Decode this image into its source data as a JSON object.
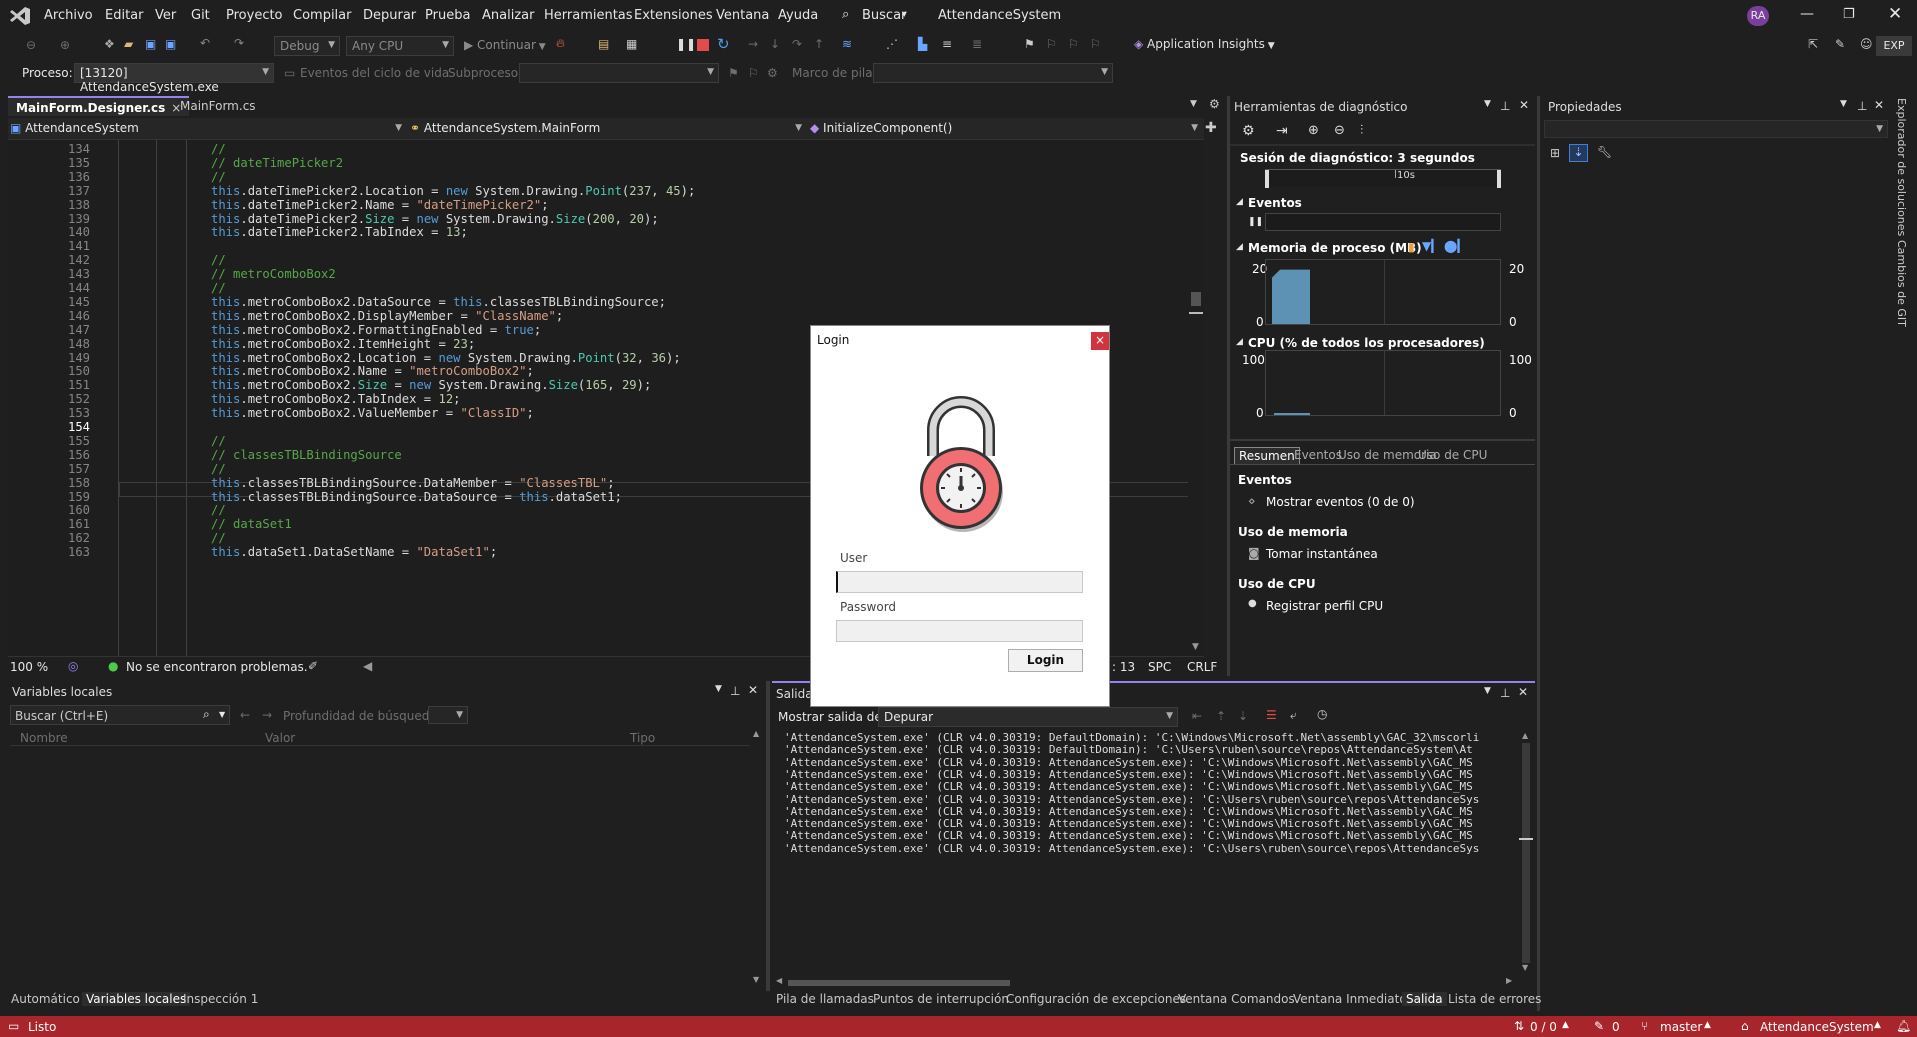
{
  "menu": [
    "Archivo",
    "Editar",
    "Ver",
    "Git",
    "Proyecto",
    "Compilar",
    "Depurar",
    "Prueba",
    "Analizar",
    "Herramientas",
    "Extensiones",
    "Ventana",
    "Ayuda"
  ],
  "search_label": "Buscar",
  "solution_title": "AttendanceSystem",
  "user_initials": "RA",
  "exp_label": "EXP",
  "toolbar": {
    "config": "Debug",
    "platform": "Any CPU",
    "continue_label": "Continuar",
    "app_insights": "Application Insights"
  },
  "toolbar2": {
    "process_label": "Proceso:",
    "process_value": "[13120] AttendanceSystem.exe",
    "lifecycle_label": "Eventos del ciclo de vida",
    "subprocess_label": "Subproceso:",
    "stackframe_label": "Marco de pila:"
  },
  "tabs": [
    "MainForm.Designer.cs",
    "MainForm.cs"
  ],
  "navbar": {
    "project": "AttendanceSystem",
    "class": "AttendanceSystem.MainForm",
    "method": "InitializeComponent()"
  },
  "code_lines": [
    {
      "n": "134",
      "t": "//"
    },
    {
      "n": "135",
      "t": "// dateTimePicker2"
    },
    {
      "n": "136",
      "t": "//"
    },
    {
      "n": "137",
      "t": "this.dateTimePicker2.Location = new System.Drawing.Point(237, 45);"
    },
    {
      "n": "138",
      "t": "this.dateTimePicker2.Name = \"dateTimePicker2\";"
    },
    {
      "n": "139",
      "t": "this.dateTimePicker2.Size = new System.Drawing.Size(200, 20);"
    },
    {
      "n": "140",
      "t": "this.dateTimePicker2.TabIndex = 13;"
    },
    {
      "n": "141",
      "t": ""
    },
    {
      "n": "142",
      "t": "//"
    },
    {
      "n": "143",
      "t": "// metroComboBox2"
    },
    {
      "n": "144",
      "t": "//"
    },
    {
      "n": "145",
      "t": "this.metroComboBox2.DataSource = this.classesTBLBindingSource;"
    },
    {
      "n": "146",
      "t": "this.metroComboBox2.DisplayMember = \"ClassName\";"
    },
    {
      "n": "147",
      "t": "this.metroComboBox2.FormattingEnabled = true;"
    },
    {
      "n": "148",
      "t": "this.metroComboBox2.ItemHeight = 23;"
    },
    {
      "n": "149",
      "t": "this.metroComboBox2.Location = new System.Drawing.Point(32, 36);"
    },
    {
      "n": "150",
      "t": "this.metroComboBox2.Name = \"metroComboBox2\";"
    },
    {
      "n": "151",
      "t": "this.metroComboBox2.Size = new System.Drawing.Size(165, 29);"
    },
    {
      "n": "152",
      "t": "this.metroComboBox2.TabIndex = 12;"
    },
    {
      "n": "153",
      "t": "this.metroComboBox2.ValueMember = \"ClassID\";"
    },
    {
      "n": "154",
      "t": ""
    },
    {
      "n": "155",
      "t": "//"
    },
    {
      "n": "156",
      "t": "// classesTBLBindingSource"
    },
    {
      "n": "157",
      "t": "//"
    },
    {
      "n": "158",
      "t": "this.classesTBLBindingSource.DataMember = \"ClassesTBL\";"
    },
    {
      "n": "159",
      "t": "this.classesTBLBindingSource.DataSource = this.dataSet1;"
    },
    {
      "n": "160",
      "t": "//"
    },
    {
      "n": "161",
      "t": "// dataSet1"
    },
    {
      "n": "162",
      "t": "//"
    },
    {
      "n": "163",
      "t": "this.dataSet1.DataSetName = \"DataSet1\";"
    }
  ],
  "editor_status": {
    "zoom": "100 %",
    "problems": "No se encontraron problemas.",
    "col": ": 13",
    "spc": "SPC",
    "crlf": "CRLF"
  },
  "diag": {
    "title": "Herramientas de diagnóstico",
    "session": "Sesión de diagnóstico: 3 segundos",
    "timeline_tick": "10s",
    "events": "Eventos",
    "memory_title": "Memoria de proceso (MB)",
    "mem_max": "20",
    "mem_min": "0",
    "cpu_title": "CPU (% de todos los procesadores)",
    "cpu_max": "100",
    "cpu_min": "0",
    "tabs": [
      "Resumen",
      "Eventos",
      "Uso de memoria",
      "Uso de CPU"
    ],
    "sec_events": "Eventos",
    "show_events": "Mostrar eventos (0 de 0)",
    "sec_memory": "Uso de memoria",
    "snapshot": "Tomar instantánea",
    "sec_cpu": "Uso de CPU",
    "cpu_profile": "Registrar perfil CPU",
    "memory_fill": 0.85
  },
  "properties": {
    "title": "Propiedades"
  },
  "side_tabs": [
    "Explorador de soluciones",
    "Cambios de GIT"
  ],
  "locals": {
    "title": "Variables locales",
    "search_placeholder": "Buscar (Ctrl+E)",
    "depth_label": "Profundidad de búsqueda:",
    "col_name": "Nombre",
    "col_value": "Valor",
    "col_type": "Tipo"
  },
  "output": {
    "title": "Salida",
    "show_from": "Mostrar salida de:",
    "source": "Depurar",
    "lines": [
      "'AttendanceSystem.exe' (CLR v4.0.30319: DefaultDomain): 'C:\\Windows\\Microsoft.Net\\assembly\\GAC_32\\mscorli",
      "'AttendanceSystem.exe' (CLR v4.0.30319: DefaultDomain): 'C:\\Users\\ruben\\source\\repos\\AttendanceSystem\\At",
      "'AttendanceSystem.exe' (CLR v4.0.30319: AttendanceSystem.exe): 'C:\\Windows\\Microsoft.Net\\assembly\\GAC_MS",
      "'AttendanceSystem.exe' (CLR v4.0.30319: AttendanceSystem.exe): 'C:\\Windows\\Microsoft.Net\\assembly\\GAC_MS",
      "'AttendanceSystem.exe' (CLR v4.0.30319: AttendanceSystem.exe): 'C:\\Windows\\Microsoft.Net\\assembly\\GAC_MS",
      "'AttendanceSystem.exe' (CLR v4.0.30319: AttendanceSystem.exe): 'C:\\Users\\ruben\\source\\repos\\AttendanceSys",
      "'AttendanceSystem.exe' (CLR v4.0.30319: AttendanceSystem.exe): 'C:\\Windows\\Microsoft.Net\\assembly\\GAC_MS",
      "'AttendanceSystem.exe' (CLR v4.0.30319: AttendanceSystem.exe): 'C:\\Windows\\Microsoft.Net\\assembly\\GAC_MS",
      "'AttendanceSystem.exe' (CLR v4.0.30319: AttendanceSystem.exe): 'C:\\Windows\\Microsoft.Net\\assembly\\GAC_MS",
      "'AttendanceSystem.exe' (CLR v4.0.30319: AttendanceSystem.exe): 'C:\\Users\\ruben\\source\\repos\\AttendanceSys"
    ]
  },
  "bottom_tabs_left": [
    "Automático",
    "Variables locales",
    "Inspección 1"
  ],
  "bottom_tabs_right": [
    "Pila de llamadas",
    "Puntos de interrupción",
    "Configuración de excepciones",
    "Ventana Comandos",
    "Ventana Inmediato",
    "Salida",
    "Lista de errores"
  ],
  "statusbar": {
    "ready": "Listo",
    "sync": "0 / 0",
    "pending": "0",
    "branch": "master",
    "solution": "AttendanceSystem"
  },
  "login": {
    "title": "Login",
    "close": "×",
    "user_label": "User",
    "password_label": "Password",
    "user_value": "",
    "password_value": "",
    "button": "Login"
  }
}
